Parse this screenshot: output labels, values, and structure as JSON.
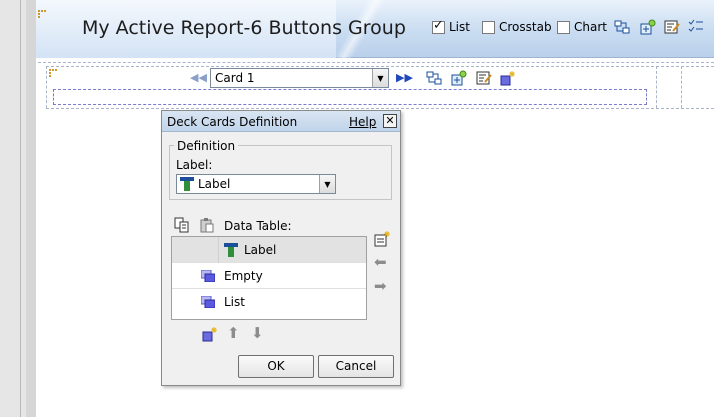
{
  "report": {
    "title": "My Active Report-6 Buttons Group",
    "view_options": [
      {
        "label": "List",
        "checked": true
      },
      {
        "label": "Crosstab",
        "checked": false
      },
      {
        "label": "Chart",
        "checked": false
      }
    ],
    "toolbar_icons": [
      "group-icon",
      "add-calculation-icon",
      "edit-properties-icon",
      "sort-filter-icon"
    ]
  },
  "navigator": {
    "selected_card": "Card 1",
    "prev_icon": "rewind-icon",
    "next_icon": "fast-forward-icon",
    "toolbar_icons": [
      "group-icon",
      "add-calculation-icon",
      "edit-properties-icon",
      "new-card-icon"
    ]
  },
  "dialog": {
    "title": "Deck Cards Definition",
    "help_label": "Help",
    "close_glyph": "✕",
    "definition": {
      "group_label": "Definition",
      "label_caption": "Label:",
      "label_value": "Label"
    },
    "data_table": {
      "caption": "Data Table:",
      "rows": [
        {
          "name": "Label",
          "icon": "label-data-item-icon"
        },
        {
          "name": "Empty",
          "icon": "card-icon"
        },
        {
          "name": "List",
          "icon": "card-icon"
        }
      ]
    },
    "ok_label": "OK",
    "cancel_label": "Cancel"
  },
  "colors": {
    "header_gradient_top": "#eaf2fb",
    "header_gradient_bottom": "#bad0ea",
    "dialog_background": "#f0f0f0",
    "accent_blue": "#1f48b8"
  }
}
